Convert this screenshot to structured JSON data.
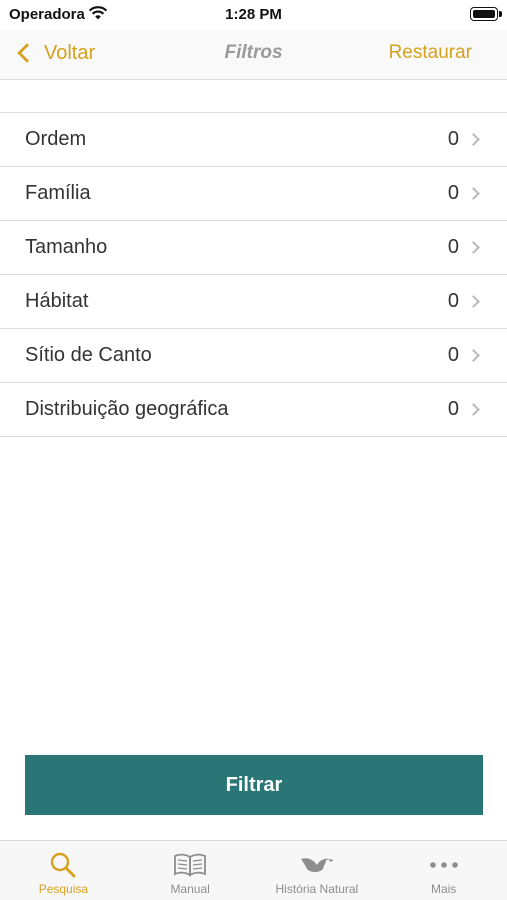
{
  "status_bar": {
    "carrier": "Operadora",
    "time": "1:28 PM"
  },
  "nav": {
    "back_label": "Voltar",
    "title": "Filtros",
    "restore_label": "Restaurar"
  },
  "filters": [
    {
      "label": "Ordem",
      "count": "0"
    },
    {
      "label": "Família",
      "count": "0"
    },
    {
      "label": "Tamanho",
      "count": "0"
    },
    {
      "label": "Hábitat",
      "count": "0"
    },
    {
      "label": "Sítio de Canto",
      "count": "0"
    },
    {
      "label": "Distribuição geográfica",
      "count": "0"
    }
  ],
  "filter_button": {
    "label": "Filtrar"
  },
  "tabs": [
    {
      "label": "Pesquisa",
      "icon": "search-icon",
      "active": true
    },
    {
      "label": "Manual",
      "icon": "book-icon",
      "active": false
    },
    {
      "label": "História Natural",
      "icon": "bird-icon",
      "active": false
    },
    {
      "label": "Mais",
      "icon": "more-icon",
      "active": false
    }
  ],
  "colors": {
    "accent": "#d6a11f",
    "button": "#2a7676",
    "inactive_tab": "#8e8e8e"
  }
}
